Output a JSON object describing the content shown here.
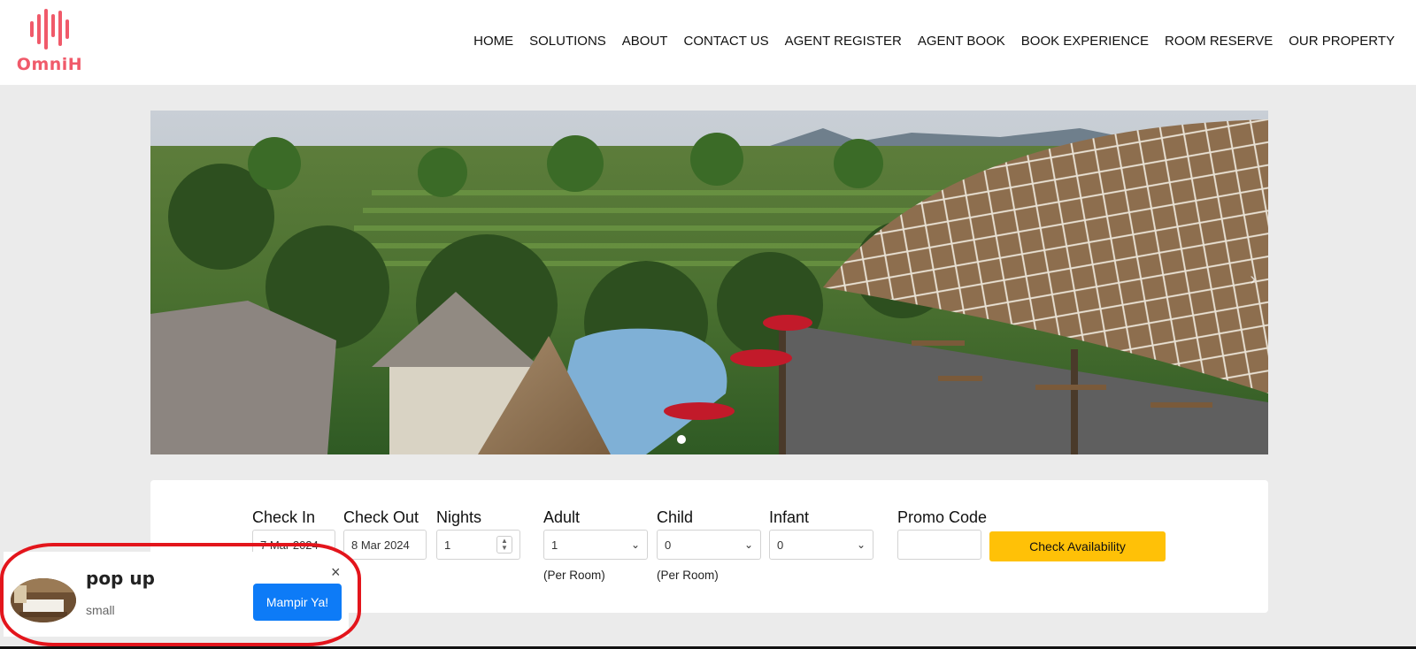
{
  "brand": {
    "name": "OmniH",
    "color": "#f05a6a"
  },
  "nav": [
    "HOME",
    "SOLUTIONS",
    "ABOUT",
    "CONTACT US",
    "AGENT REGISTER",
    "AGENT BOOK",
    "BOOK EXPERIENCE",
    "ROOM RESERVE",
    "OUR PROPERTY"
  ],
  "hero": {
    "slide_count": 1,
    "active_slide": 1,
    "next_icon": "chevron-right-icon"
  },
  "booking": {
    "check_in": {
      "label": "Check In",
      "value": "7 Mar 2024"
    },
    "check_out": {
      "label": "Check Out",
      "value": "8 Mar 2024"
    },
    "nights": {
      "label": "Nights",
      "value": "1"
    },
    "adult": {
      "label": "Adult",
      "value": "1",
      "note": "(Per Room)"
    },
    "child": {
      "label": "Child",
      "value": "0",
      "note": "(Per Room)"
    },
    "infant": {
      "label": "Infant",
      "value": "0"
    },
    "promo": {
      "label": "Promo Code",
      "value": ""
    },
    "submit_label": "Check Availability",
    "submit_color": "#ffc107"
  },
  "popup": {
    "title": "pop up",
    "subtitle": "small",
    "button_label": "Mampir Ya!",
    "button_color": "#0d7bf7",
    "close_glyph": "×",
    "highlight_color": "#e3151c"
  }
}
